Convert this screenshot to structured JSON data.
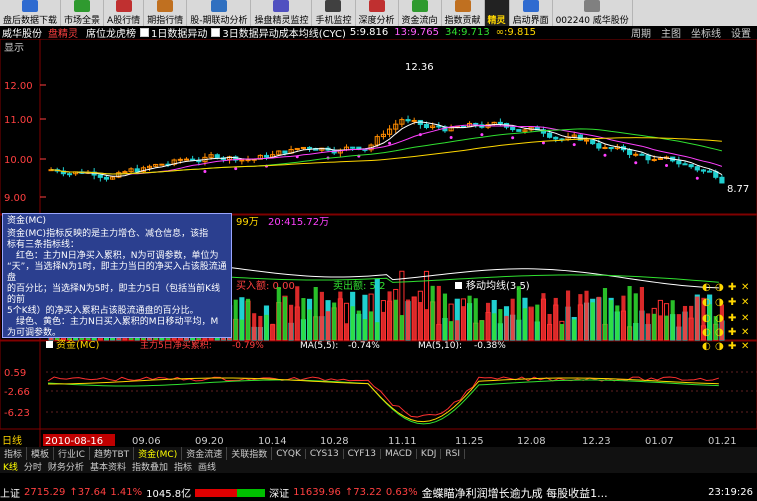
{
  "toolbar": [
    {
      "label": "盘后数据下载",
      "icon": "download-icon",
      "color": "#2f6bd0"
    },
    {
      "label": "市场全景",
      "icon": "globe-icon",
      "color": "#2f9a2f"
    },
    {
      "label": "A股行情",
      "icon": "quote-icon",
      "color": "#c03030"
    },
    {
      "label": "期指行情",
      "icon": "futures-icon",
      "color": "#c07020"
    },
    {
      "label": "股-期联动分析",
      "icon": "link-icon",
      "color": "#3070c0"
    },
    {
      "label": "操盘精灵监控",
      "icon": "monitor-icon",
      "color": "#5050c0"
    },
    {
      "label": "手机监控",
      "icon": "phone-icon",
      "color": "#404040"
    },
    {
      "label": "深度分析",
      "icon": "analysis-icon",
      "color": "#c03030"
    },
    {
      "label": "资金流向",
      "icon": "flow-icon",
      "color": "#2f9a2f"
    },
    {
      "label": "指数贡献",
      "icon": "index-icon",
      "color": "#c07020"
    },
    {
      "label": "精灵",
      "icon": "logo-icon",
      "color": "#c00000",
      "logo": true
    },
    {
      "label": "启动界面",
      "icon": "home-icon",
      "color": "#2f6bd0"
    },
    {
      "label": "002240 威华股份",
      "icon": "stock-icon",
      "color": "#808080"
    }
  ],
  "title": {
    "stock": "威华股份",
    "menu1": "盘精灵",
    "menu2": "席位龙虎榜",
    "opt1": "1日数据异动",
    "opt2": "3日数据异动成本均线(CYC)",
    "v1": "5:9.816",
    "v2": "13:9.765",
    "v3": "34:9.713",
    "v4": "∞:9.815",
    "period": "周期",
    "theme": "主图",
    "coord": "坐标线",
    "settings": "设置"
  },
  "chart": {
    "show_label": "显示",
    "y_labels": [
      "12.00",
      "11.00",
      "10.00",
      "9.00"
    ],
    "high_label": "12.36",
    "low_label": "8.77",
    "vol_label_a": "99万",
    "vol_label_b": "20:415.72万",
    "buy_label": "买入额: 0.00",
    "sell_label": "卖出额: 5.2",
    "ma_label": "移动均线(3,5)",
    "mc_bar": "资金(MC)",
    "mc_sub1": "主力5日净买累积:",
    "mc_sub1v": "-0.79%",
    "mc_sub2": "MA(5,5):",
    "mc_sub2v": "-0.74%",
    "mc_sub3": "MA(5,10):",
    "mc_sub3v": "-0.38%",
    "ind_labels": [
      "0.59",
      "-2.66",
      "-6.23"
    ],
    "dates": [
      "2010-08-16",
      "09.06",
      "09.20",
      "10.14",
      "10.28",
      "11.11",
      "11.25",
      "12.08",
      "12.23",
      "01.07",
      "01.21"
    ],
    "day_label": "日线"
  },
  "popup": {
    "title": "资金(MC)",
    "lines": [
      "资金(MC)指标反映的是主力增仓、减仓信息，该指",
      "标有三条指标线：",
      "　红色：主力N日净买入累积，N为可调参数，单位为",
      "“天”，当选择N为1时，即主力当日的净买入占该股流通盘",
      "的百分比；当选择N为5时，即主力5日（包括当前K线的前",
      "5个K线）的净买入累积占该股流通盘的百分比。",
      "　绿色、黄色：主力N日买入累积的M日移动平均，M",
      "为可调参数。"
    ]
  },
  "tabs": [
    "指标",
    "模板",
    "行业IC",
    "趋势TBT",
    "资金(MC)",
    "资金流速",
    "关联指数",
    "CYQK",
    "CYS13",
    "CYF13",
    "MACD",
    "KDJ",
    "RSI"
  ],
  "nav": [
    "K线",
    "分时",
    "财务分析",
    "基本资料",
    "指数叠加",
    "指标",
    "画线"
  ],
  "status": {
    "sh_label": "上证",
    "sh_value": "2715.29",
    "sh_change": "↑37.64",
    "sh_pct": "1.41%",
    "sh_amount": "1045.8亿",
    "sz_label": "深证",
    "sz_value": "11639.96",
    "sz_change": "↑73.22",
    "sz_pct": "0.63%",
    "news": "金蝶瞄净利润增长逾九成 每股收益1...",
    "time": "23:19:26"
  }
}
